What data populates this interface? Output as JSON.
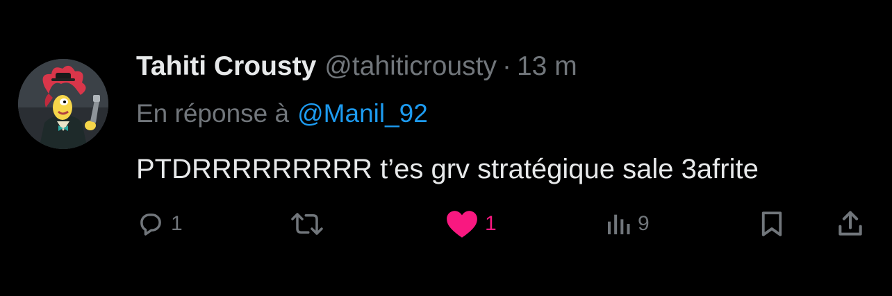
{
  "tweet": {
    "author": {
      "display_name": "Tahiti Crousty",
      "handle": "@tahiticrousty",
      "avatar_icon": "cartoon-character-avatar"
    },
    "separator": "·",
    "time": "13 m",
    "reply_to": {
      "prefix": "En réponse à",
      "mention": "@Manil_92"
    },
    "text": "PTDRRRRRRRRR t’es grv stratégique sale 3afrite",
    "actions": {
      "reply": {
        "icon": "reply-bubble-icon",
        "count": "1"
      },
      "retweet": {
        "icon": "retweet-icon",
        "count": ""
      },
      "like": {
        "icon": "heart-icon",
        "count": "1",
        "liked": true,
        "color": "#f91880"
      },
      "views": {
        "icon": "views-bar-chart-icon",
        "count": "9"
      },
      "bookmark": {
        "icon": "bookmark-icon"
      },
      "share": {
        "icon": "share-icon"
      }
    }
  },
  "colors": {
    "background": "#000000",
    "primary_text": "#e7e9ea",
    "secondary_text": "#71767b",
    "link": "#1d9bf0",
    "like": "#f91880"
  }
}
